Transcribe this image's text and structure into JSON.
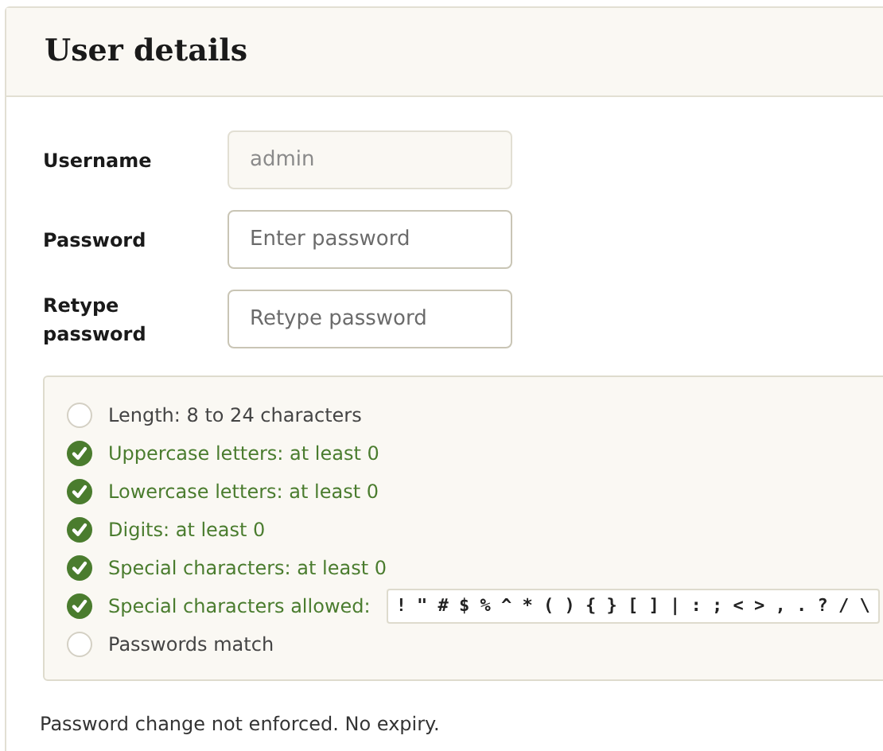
{
  "card": {
    "title": "User details"
  },
  "fields": [
    {
      "label": "Username",
      "value": "admin",
      "disabled": true
    },
    {
      "label": "Password",
      "placeholder": "Enter password",
      "disabled": false
    },
    {
      "label": "Retype password",
      "placeholder": "Retype password",
      "disabled": false
    }
  ],
  "requirements": [
    {
      "text": "Length: 8 to 24 characters",
      "checked": false
    },
    {
      "text": "Uppercase letters: at least 0",
      "checked": true
    },
    {
      "text": "Lowercase letters: at least 0",
      "checked": true
    },
    {
      "text": "Digits: at least 0",
      "checked": true
    },
    {
      "text": "Special characters: at least 0",
      "checked": true
    },
    {
      "text": "Special characters allowed:",
      "checked": true,
      "chars": "! \" # $ % ^ * ( ) { } [ ] | : ; < > , . ? / \\"
    },
    {
      "text": "Passwords match",
      "checked": false
    }
  ],
  "footer": "Password change not enforced. No expiry."
}
